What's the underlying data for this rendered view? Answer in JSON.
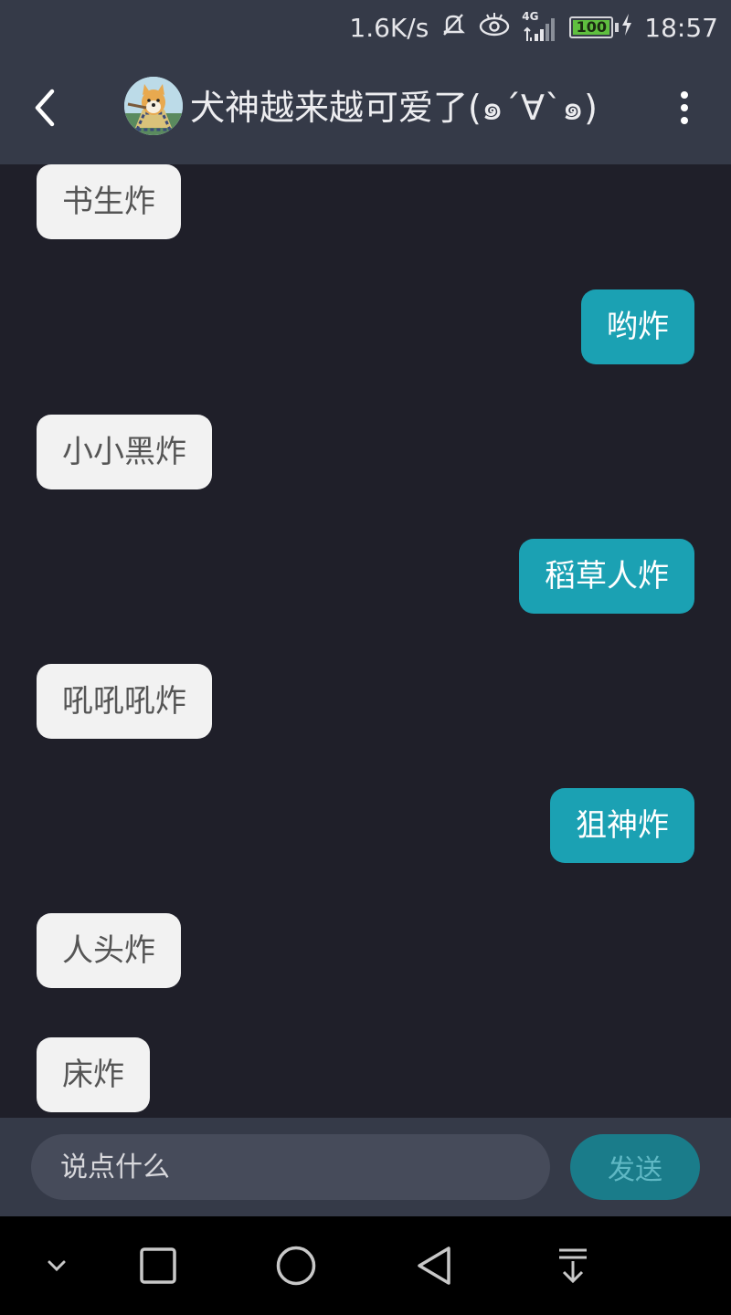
{
  "status_bar": {
    "net_speed": "1.6K/s",
    "network_type": "4G",
    "battery_level": "100",
    "time": "18:57",
    "icons": [
      "mute-icon",
      "eye-icon",
      "signal-icon",
      "battery-icon",
      "charging-icon"
    ]
  },
  "header": {
    "title": "犬神越来越可爱了(๑´∀`๑)",
    "back_icon": "chevron-left-icon",
    "more_icon": "more-vertical-icon"
  },
  "messages": [
    {
      "side": "left",
      "text": "书生炸"
    },
    {
      "side": "right",
      "text": "哟炸"
    },
    {
      "side": "left",
      "text": "小小黑炸"
    },
    {
      "side": "right",
      "text": "稻草人炸"
    },
    {
      "side": "left",
      "text": "吼吼吼炸"
    },
    {
      "side": "right",
      "text": "狙神炸"
    },
    {
      "side": "left",
      "text": "人头炸"
    },
    {
      "side": "left",
      "text": "床炸"
    }
  ],
  "input": {
    "placeholder": "说点什么",
    "value": "",
    "send_label": "发送"
  },
  "nav_bar": {
    "icons": [
      "chevron-down-icon",
      "square-icon",
      "circle-icon",
      "triangle-back-icon",
      "notification-pull-icon"
    ]
  },
  "colors": {
    "header_bg": "#353a48",
    "chat_bg": "#1f1f29",
    "bubble_incoming": "#f2f2f2",
    "bubble_outgoing": "#1ba1b3",
    "send_button": "#1a7c8a"
  }
}
